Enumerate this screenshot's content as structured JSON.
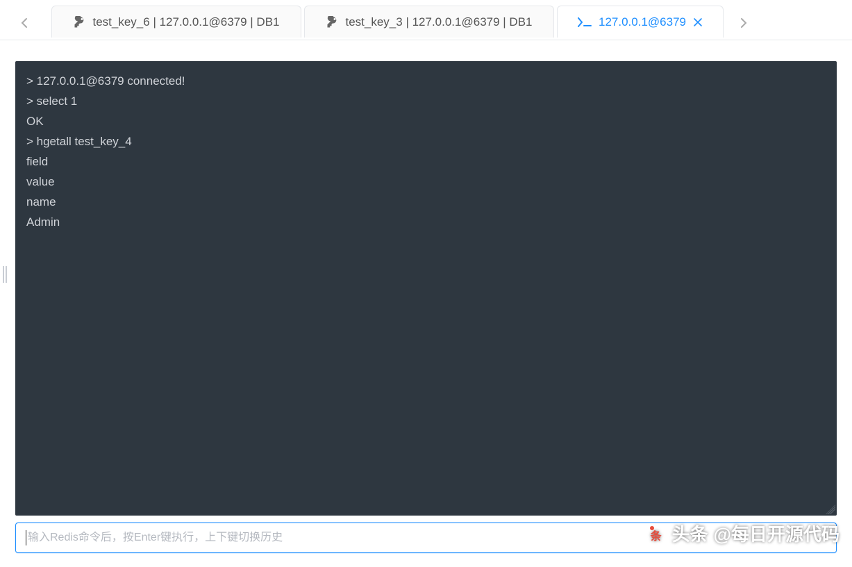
{
  "tabs": [
    {
      "icon": "key",
      "label": "test_key_6 | 127.0.0.1@6379 | DB1",
      "active": false,
      "closeable": false
    },
    {
      "icon": "key",
      "label": "test_key_3 | 127.0.0.1@6379 | DB1",
      "active": false,
      "closeable": false
    },
    {
      "icon": "terminal",
      "label": "127.0.0.1@6379",
      "active": true,
      "closeable": true
    }
  ],
  "terminal": {
    "lines": [
      "> 127.0.0.1@6379 connected!",
      "> select 1",
      "OK",
      "> hgetall test_key_4",
      "field",
      "value",
      "name",
      "Admin"
    ]
  },
  "command_input": {
    "value": "",
    "placeholder": "输入Redis命令后，按Enter键执行，上下键切换历史"
  },
  "watermark": {
    "brand": "头条",
    "text": "@每日开源代码"
  },
  "colors": {
    "accent": "#1f8fff",
    "terminal_bg": "#2e3740",
    "terminal_fg": "#d0d3d8"
  }
}
